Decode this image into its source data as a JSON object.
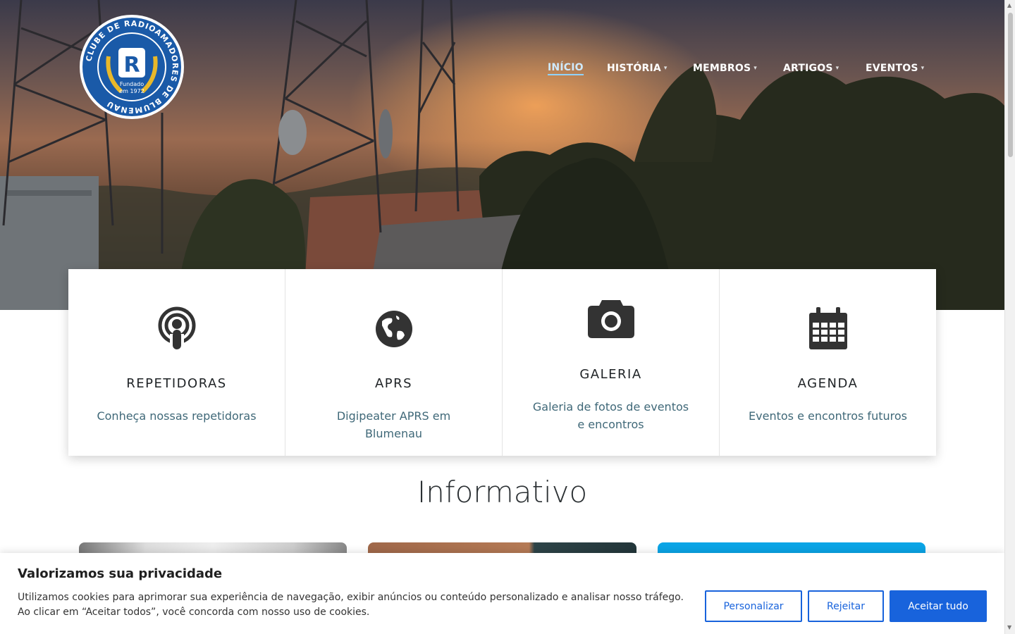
{
  "logo": {
    "ring_text": "CLUBE DE RADIOAMADORES DE BLUMENAU",
    "line1": "Fundado",
    "line2": "em 1972"
  },
  "nav": [
    {
      "label": "INÍCIO",
      "active": true,
      "dropdown": false
    },
    {
      "label": "HISTÓRIA",
      "active": false,
      "dropdown": true
    },
    {
      "label": "MEMBROS",
      "active": false,
      "dropdown": true
    },
    {
      "label": "ARTIGOS",
      "active": false,
      "dropdown": true
    },
    {
      "label": "EVENTOS",
      "active": false,
      "dropdown": true
    }
  ],
  "features": [
    {
      "icon": "podcast-icon",
      "title": "REPETIDORAS",
      "desc": "Conheça nossas repetidoras"
    },
    {
      "icon": "globe-icon",
      "title": "APRS",
      "desc": "Digipeater APRS em Blumenau"
    },
    {
      "icon": "camera-icon",
      "title": "GALERIA",
      "desc": "Galeria de fotos de eventos e encontros"
    },
    {
      "icon": "calendar-icon",
      "title": "AGENDA",
      "desc": "Eventos e encontros futuros"
    }
  ],
  "section_title": "Informativo",
  "cookie": {
    "title": "Valorizamos sua privacidade",
    "text": "Utilizamos cookies para aprimorar sua experiência de navegação, exibir anúncios ou conteúdo personalizado e analisar nosso tráfego. Ao clicar em “Aceitar todos”, você concorda com nosso uso de cookies.",
    "customize": "Personalizar",
    "reject": "Rejeitar",
    "accept": "Aceitar tudo"
  },
  "colors": {
    "accent": "#1863dc",
    "link": "#3f6878",
    "logo_blue": "#1a5aa8",
    "logo_gold": "#e8b82a"
  }
}
